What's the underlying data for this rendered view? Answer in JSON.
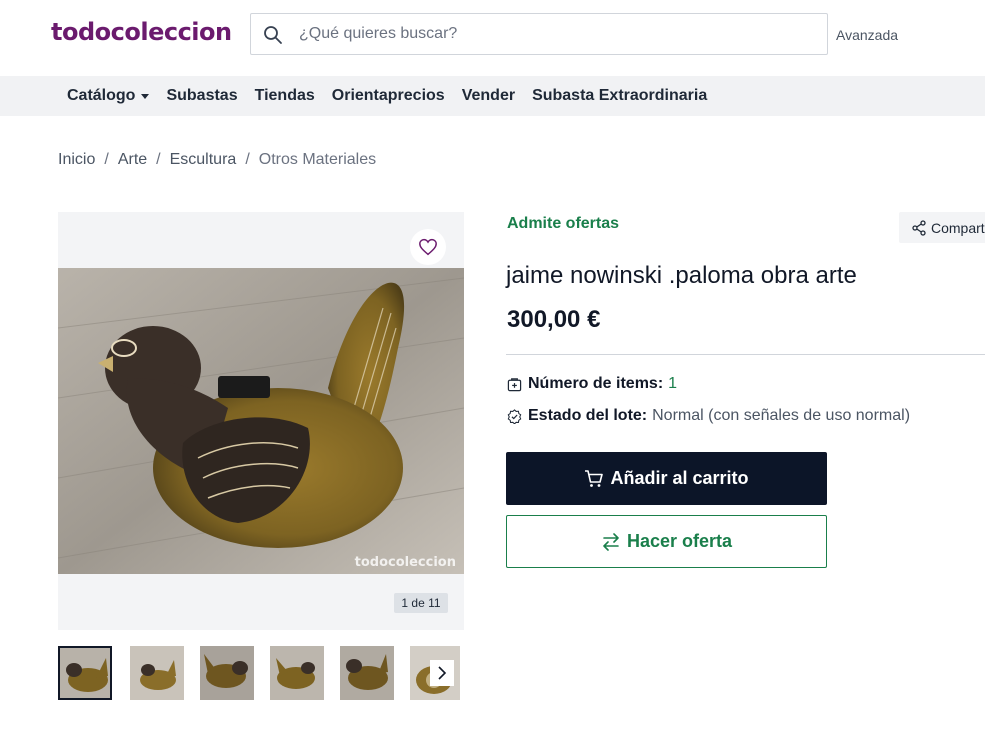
{
  "header": {
    "logo": "todocoleccion",
    "search_placeholder": "¿Qué quieres buscar?",
    "advanced_label": "Avanzada"
  },
  "nav": {
    "items": [
      {
        "label": "Catálogo",
        "has_dropdown": true
      },
      {
        "label": "Subastas"
      },
      {
        "label": "Tiendas"
      },
      {
        "label": "Orientaprecios"
      },
      {
        "label": "Vender"
      },
      {
        "label": "Subasta Extraordinaria"
      }
    ]
  },
  "breadcrumb": [
    "Inicio",
    "Arte",
    "Escultura",
    "Otros Materiales"
  ],
  "gallery": {
    "watermark": "todocoleccion",
    "counter": "1 de 11",
    "thumbnail_count_visible": 6
  },
  "product": {
    "offers_label": "Admite ofertas",
    "share_label": "Compartir",
    "title": "jaime nowinski .paloma obra arte",
    "price": "300,00 €",
    "items_label": "Número de items:",
    "items_value": "1",
    "state_label": "Estado del lote:",
    "state_value": "Normal (con señales de uso normal)",
    "cart_button": "Añadir al carrito",
    "offer_button": "Hacer oferta"
  },
  "colors": {
    "brand": "#6b1b6e",
    "accent_green": "#1a7f4b",
    "dark_button": "#0c1528",
    "nav_bg": "#f1f2f4"
  }
}
